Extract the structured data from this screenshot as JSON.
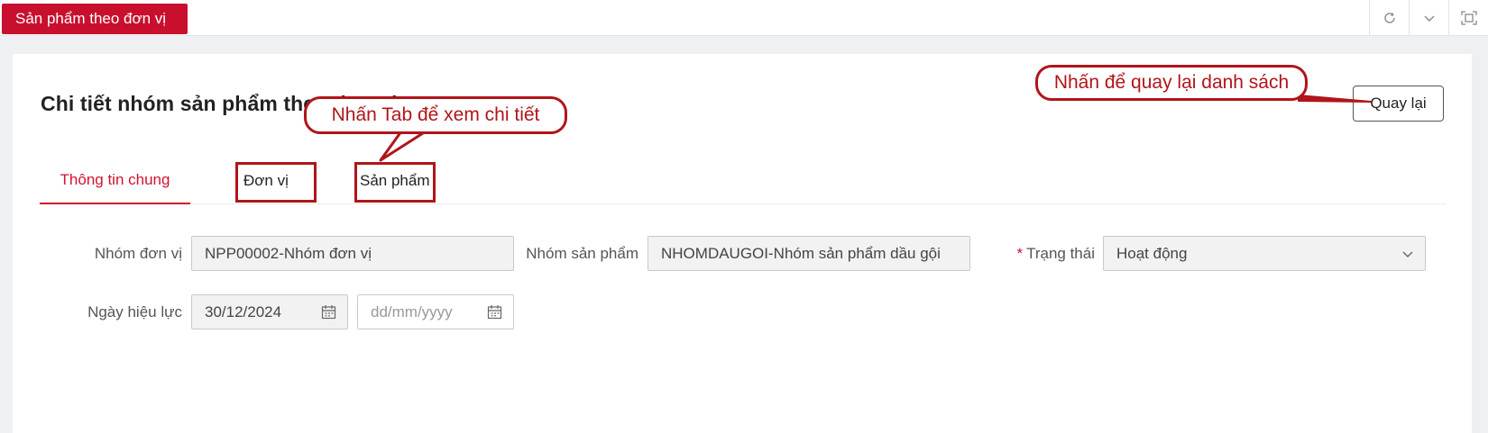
{
  "topbar": {
    "active_tab": "Sản phẩm theo đơn vị",
    "actions": [
      "refresh-icon",
      "chevron-down-icon",
      "fullscreen-icon"
    ]
  },
  "page": {
    "title": "Chi tiết nhóm sản phẩm theo đơn vị",
    "back_label": "Quay lại"
  },
  "tabs": [
    {
      "label": "Thông tin chung",
      "active": true
    },
    {
      "label": "Đơn vị",
      "active": false
    },
    {
      "label": "Sản phẩm",
      "active": false
    }
  ],
  "form": {
    "unit_group_label": "Nhóm đơn vị",
    "unit_group_value": "NPP00002-Nhóm đơn vị",
    "product_group_label": "Nhóm sản phẩm",
    "product_group_value": "NHOMDAUGOI-Nhóm sản phẩm dầu gội",
    "status_label": "Trạng thái",
    "status_value": "Hoạt động",
    "effective_date_label": "Ngày hiệu lực",
    "effective_from": "30/12/2024",
    "effective_to_placeholder": "dd/mm/yyyy"
  },
  "callouts": {
    "back_hint": "Nhấn để quay lại danh sách",
    "tab_hint": "Nhấn Tab để xem chi tiết"
  },
  "colors": {
    "brand": "#c8102e",
    "annotation": "#b0151a"
  }
}
